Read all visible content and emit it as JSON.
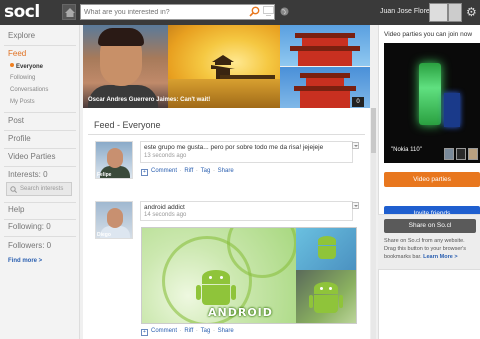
{
  "header": {
    "logo": "socl",
    "search_placeholder": "What are you interested in?",
    "username": "Juan Jose Flores"
  },
  "sidebar": {
    "explore": "Explore",
    "feed": "Feed",
    "feed_items": [
      "Everyone",
      "Following",
      "Conversations",
      "My Posts"
    ],
    "post": "Post",
    "profile": "Profile",
    "video_parties": "Video Parties",
    "interests": "Interests: 0",
    "search_interests": "Search interests",
    "help": "Help",
    "following": "Following: 0",
    "followers": "Followers: 0",
    "find_more": "Find more >"
  },
  "hero": {
    "caption": "Oscar Andres Guerrero Jaimes: Can't wait!",
    "count": "0"
  },
  "feed": {
    "title": "Feed - Everyone",
    "posts": [
      {
        "author": "Felipe",
        "text": "este grupo me gusta... pero por sobre todo me da risa! jejejeje",
        "time": "13 seconds ago",
        "actions": [
          "Comment",
          "Riff",
          "Tag",
          "Share"
        ]
      },
      {
        "author": "Diego",
        "text": "android addict",
        "time": "14 seconds ago",
        "actions": [
          "Comment",
          "Riff",
          "Tag",
          "Share"
        ],
        "image_word": "ANDROID"
      }
    ]
  },
  "right": {
    "video_title": "Video parties you can join now",
    "video_caption": "\"Nokia 110\"",
    "video_button": "Video parties",
    "invite_button": "Invite friends",
    "share_button": "Share on So.cl",
    "share_desc_1": "Share on So.cl from any website. Drag this button to your browser's bookmarks bar.",
    "learn_more": "Learn More >"
  },
  "colors": {
    "accent_orange": "#e8771e",
    "accent_blue": "#1f5fcf",
    "topbar": "#3a3a3a"
  }
}
